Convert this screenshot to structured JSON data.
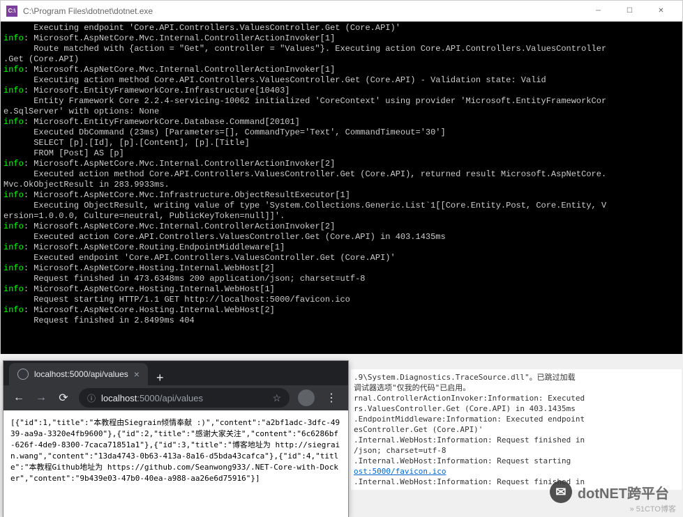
{
  "console": {
    "title": "C:\\Program Files\\dotnet\\dotnet.exe",
    "icon_text": "C:\\",
    "lines": [
      {
        "indent": true,
        "text": "Executing endpoint 'Core.API.Controllers.ValuesController.Get (Core.API)'"
      },
      {
        "info": true,
        "text": "Microsoft.AspNetCore.Mvc.Internal.ControllerActionInvoker[1]"
      },
      {
        "indent": true,
        "text": "Route matched with {action = \"Get\", controller = \"Values\"}. Executing action Core.API.Controllers.ValuesController"
      },
      {
        "cont": true,
        "text": ".Get (Core.API)"
      },
      {
        "info": true,
        "text": "Microsoft.AspNetCore.Mvc.Internal.ControllerActionInvoker[1]"
      },
      {
        "indent": true,
        "text": "Executing action method Core.API.Controllers.ValuesController.Get (Core.API) - Validation state: Valid"
      },
      {
        "info": true,
        "text": "Microsoft.EntityFrameworkCore.Infrastructure[10403]"
      },
      {
        "indent": true,
        "text": "Entity Framework Core 2.2.4-servicing-10062 initialized 'CoreContext' using provider 'Microsoft.EntityFrameworkCor"
      },
      {
        "cont": true,
        "text": "e.SqlServer' with options: None"
      },
      {
        "info": true,
        "text": "Microsoft.EntityFrameworkCore.Database.Command[20101]"
      },
      {
        "indent": true,
        "text": "Executed DbCommand (23ms) [Parameters=[], CommandType='Text', CommandTimeout='30']"
      },
      {
        "indent": true,
        "text": "SELECT [p].[Id], [p].[Content], [p].[Title]"
      },
      {
        "indent": true,
        "text": "FROM [Post] AS [p]"
      },
      {
        "info": true,
        "text": "Microsoft.AspNetCore.Mvc.Internal.ControllerActionInvoker[2]"
      },
      {
        "indent": true,
        "text": "Executed action method Core.API.Controllers.ValuesController.Get (Core.API), returned result Microsoft.AspNetCore."
      },
      {
        "cont": true,
        "text": "Mvc.OkObjectResult in 283.9933ms."
      },
      {
        "info": true,
        "text": "Microsoft.AspNetCore.Mvc.Infrastructure.ObjectResultExecutor[1]"
      },
      {
        "indent": true,
        "text": "Executing ObjectResult, writing value of type 'System.Collections.Generic.List`1[[Core.Entity.Post, Core.Entity, V"
      },
      {
        "cont": true,
        "text": "ersion=1.0.0.0, Culture=neutral, PublicKeyToken=null]]'."
      },
      {
        "info": true,
        "text": "Microsoft.AspNetCore.Mvc.Internal.ControllerActionInvoker[2]"
      },
      {
        "indent": true,
        "text": "Executed action Core.API.Controllers.ValuesController.Get (Core.API) in 403.1435ms"
      },
      {
        "info": true,
        "text": "Microsoft.AspNetCore.Routing.EndpointMiddleware[1]"
      },
      {
        "indent": true,
        "text": "Executed endpoint 'Core.API.Controllers.ValuesController.Get (Core.API)'"
      },
      {
        "info": true,
        "text": "Microsoft.AspNetCore.Hosting.Internal.WebHost[2]"
      },
      {
        "indent": true,
        "text": "Request finished in 473.6348ms 200 application/json; charset=utf-8"
      },
      {
        "info": true,
        "text": "Microsoft.AspNetCore.Hosting.Internal.WebHost[1]"
      },
      {
        "indent": true,
        "text": "Request starting HTTP/1.1 GET http://localhost:5000/favicon.ico"
      },
      {
        "info": true,
        "text": "Microsoft.AspNetCore.Hosting.Internal.WebHost[2]"
      },
      {
        "indent": true,
        "text": "Request finished in 2.8499ms 404"
      }
    ]
  },
  "browser": {
    "tab_title": "localhost:5000/api/values",
    "url_host": "localhost",
    "url_path": ":5000/api/values",
    "content": "[{\"id\":1,\"title\":\"本教程由Siegrain倾情奉献 :)\",\"content\":\"a2bf1adc-3dfc-4939-aa9a-3320e4fb9600\"},{\"id\":2,\"title\":\"感谢大家关注\",\"content\":\"6c6286bf-626f-4de9-8300-7caca71851a1\"},{\"id\":3,\"title\":\"博客地址为 http://siegrain.wang\",\"content\":\"13da4743-0b63-413a-8a16-d5bda43cafca\"},{\"id\":4,\"title\":\"本教程Github地址为 https://github.com/Seanwong933/.NET-Core-with-Docker\",\"content\":\"9b439e03-47b0-40ea-a988-aa26e6d75916\"}]"
  },
  "ide": {
    "lines": [
      ".9\\System.Diagnostics.TraceSource.dll\"。已跳过加载",
      "调试器选项\"仅我的代码\"已启用。",
      "rnal.ControllerActionInvoker:Information: Executed",
      "rs.ValuesController.Get (Core.API) in 403.1435ms",
      ".EndpointMiddleware:Information: Executed endpoint",
      "esController.Get (Core.API)'",
      ".Internal.WebHost:Information: Request finished in",
      "/json; charset=utf-8",
      ".Internal.WebHost:Information: Request starting",
      "ost:5000/favicon.ico",
      ".Internal.WebHost:Information: Request finished in"
    ],
    "link_index": 9
  },
  "watermark": {
    "text1": "dotNET跨平台",
    "text2": "» 51CTO博客"
  }
}
